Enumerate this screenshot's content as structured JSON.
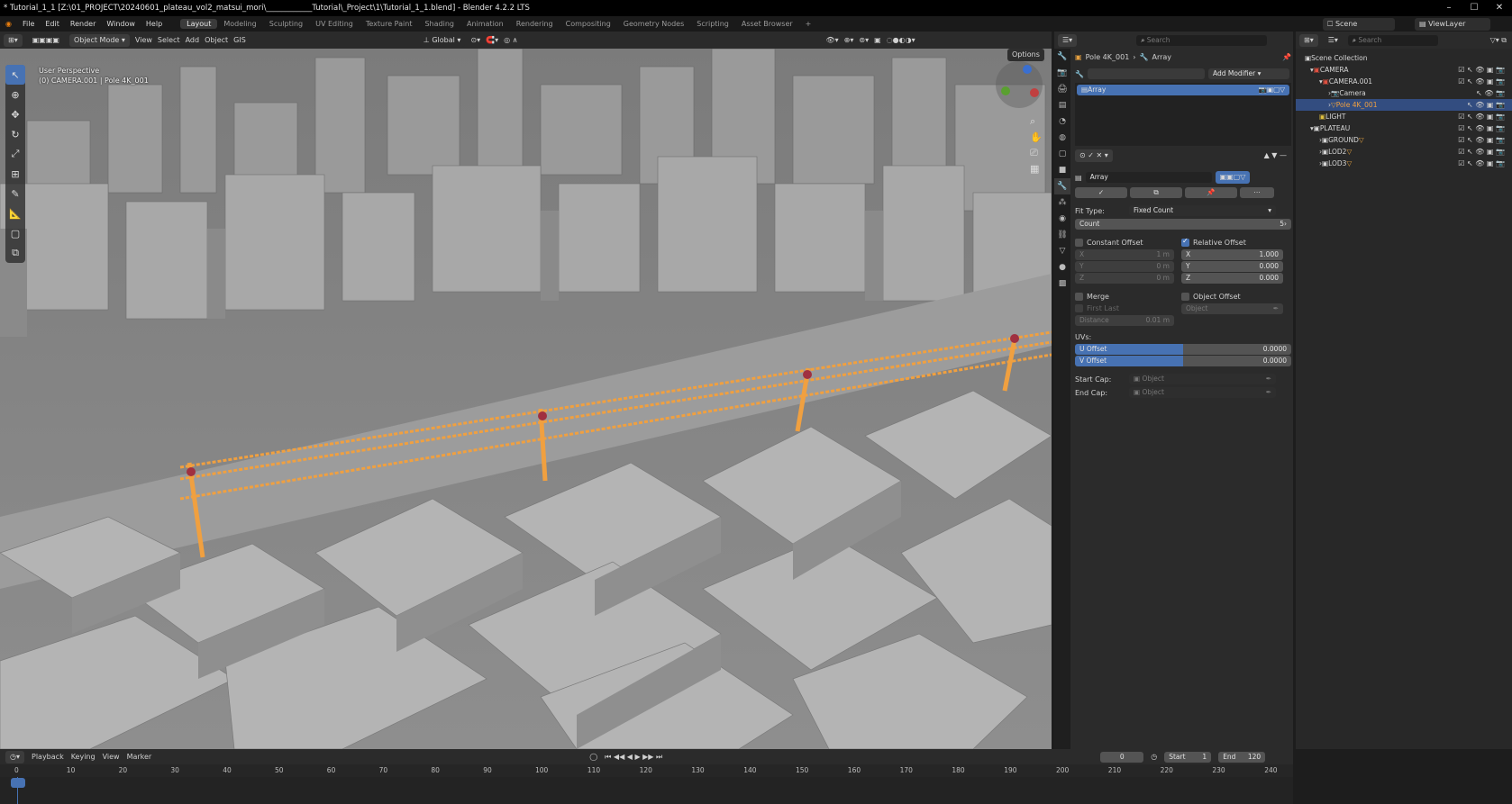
{
  "window": {
    "title": "* Tutorial_1_1 [Z:\\01_PROJECT\\20240601_plateau_vol2_matsui_mori\\____________Tutorial\\_Project\\1\\Tutorial_1_1.blend] - Blender 4.2.2 LTS"
  },
  "menubar": {
    "menus": [
      "File",
      "Edit",
      "Render",
      "Window",
      "Help"
    ],
    "workspaces": [
      "Layout",
      "Modeling",
      "Sculpting",
      "UV Editing",
      "Texture Paint",
      "Shading",
      "Animation",
      "Rendering",
      "Compositing",
      "Geometry Nodes",
      "Scripting",
      "Asset Browser"
    ],
    "active_workspace": "Layout",
    "scene": "Scene",
    "view_layer": "ViewLayer"
  },
  "viewport": {
    "mode": "Object Mode",
    "menus": [
      "View",
      "Select",
      "Add",
      "Object"
    ],
    "gis": "GIS",
    "orientation": "Global",
    "options_label": "Options",
    "overlay_line1": "User Perspective",
    "overlay_line2": "(0) CAMERA.001 | Pole 4K_001"
  },
  "properties": {
    "search_placeholder": "Search",
    "breadcrumb_object": "Pole 4K_001",
    "breadcrumb_modifier": "Array",
    "add_modifier": "Add Modifier",
    "modifier_list": [
      "Array"
    ],
    "modifier_name": "Array",
    "fit_type_label": "Fit Type:",
    "fit_type_value": "Fixed Count",
    "count_label": "Count",
    "count_value": "5",
    "constant_offset": "Constant Offset",
    "relative_offset": "Relative Offset",
    "const_x": "1 m",
    "const_y": "0 m",
    "const_z": "0 m",
    "rel_x": "1.000",
    "rel_y": "0.000",
    "rel_z": "0.000",
    "x_label": "X",
    "y_label": "Y",
    "z_label": "Z",
    "merge": "Merge",
    "object_offset": "Object Offset",
    "first_last": "First Last",
    "distance_label": "Distance",
    "distance_value": "0.01 m",
    "object_placeholder": "Object",
    "uvs_label": "UVs:",
    "u_offset_label": "U Offset",
    "u_offset_value": "0.0000",
    "v_offset_label": "V Offset",
    "v_offset_value": "0.0000",
    "start_cap": "Start Cap:",
    "end_cap": "End Cap:"
  },
  "outliner": {
    "search_placeholder": "Search",
    "root": "Scene Collection",
    "rows": [
      {
        "label": "CAMERA",
        "indent": 1,
        "type": "collection"
      },
      {
        "label": "CAMERA.001",
        "indent": 2,
        "type": "collection"
      },
      {
        "label": "Camera",
        "indent": 3,
        "type": "camera"
      },
      {
        "label": "Pole 4K_001",
        "indent": 3,
        "type": "mesh",
        "selected": true
      },
      {
        "label": "LIGHT",
        "indent": 1,
        "type": "collection"
      },
      {
        "label": "PLATEAU",
        "indent": 1,
        "type": "collection"
      },
      {
        "label": "GROUND",
        "indent": 2,
        "type": "collection"
      },
      {
        "label": "LOD2",
        "indent": 2,
        "type": "collection"
      },
      {
        "label": "LOD3",
        "indent": 2,
        "type": "collection"
      }
    ]
  },
  "timeline": {
    "menus": [
      "Playback",
      "Keying",
      "View",
      "Marker"
    ],
    "current_frame": "0",
    "start_label": "Start",
    "start_value": "1",
    "end_label": "End",
    "end_value": "120",
    "ticks": [
      "0",
      "10",
      "20",
      "30",
      "40",
      "50",
      "60",
      "70",
      "80",
      "90",
      "100",
      "110",
      "120",
      "130",
      "140",
      "150",
      "160",
      "170",
      "180",
      "190",
      "200",
      "210",
      "220",
      "230",
      "240"
    ]
  },
  "colors": {
    "accent": "#4772b3",
    "selection_orange": "#f0a040",
    "background": "#1d1d1d"
  }
}
